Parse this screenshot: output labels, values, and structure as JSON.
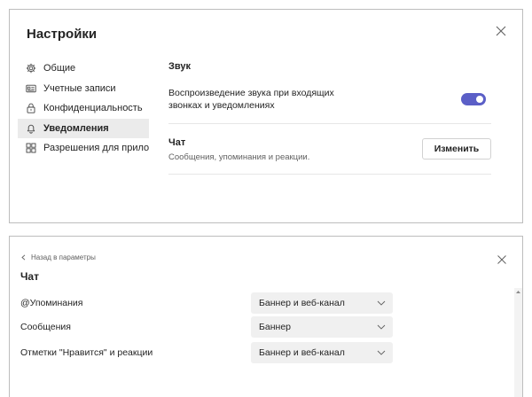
{
  "settings_panel": {
    "title": "Настройки",
    "nav": [
      {
        "label": "Общие",
        "icon": "gear-icon"
      },
      {
        "label": "Учетные записи",
        "icon": "accounts-card-icon"
      },
      {
        "label": "Конфиденциальность",
        "icon": "lock-icon"
      },
      {
        "label": "Уведомления",
        "icon": "bell-icon",
        "active": true
      },
      {
        "label": "Разрешения для прило...",
        "icon": "apps-grid-icon"
      }
    ],
    "sound": {
      "heading": "Звук",
      "description": "Воспроизведение звука при входящих звонках и уведомлениях",
      "toggle_on": true
    },
    "chat": {
      "heading": "Чат",
      "description": "Сообщения, упоминания и реакции.",
      "button_label": "Изменить"
    },
    "accent_color": "#5b5fc7"
  },
  "chat_panel": {
    "back_label": "Назад в параметры",
    "title": "Чат",
    "rows": [
      {
        "label": "@Упоминания",
        "value": "Баннер и веб-канал"
      },
      {
        "label": "Сообщения",
        "value": "Баннер"
      },
      {
        "label": "Отметки \"Нравится\" и реакции",
        "value": "Баннер и веб-канал"
      }
    ]
  }
}
